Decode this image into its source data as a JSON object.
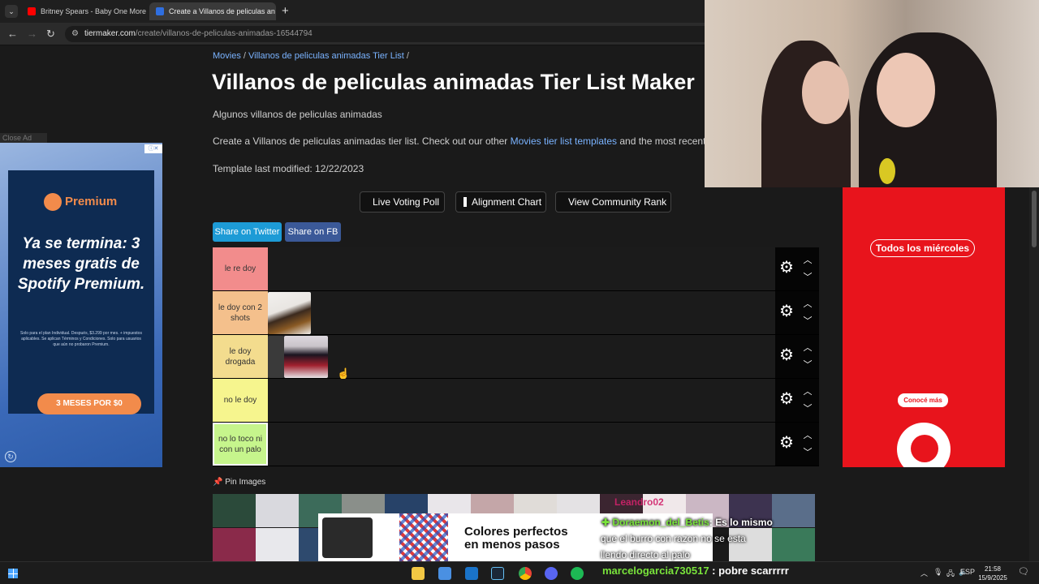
{
  "browser": {
    "tabs": [
      {
        "title": "Britney Spears - Baby One More",
        "icon": "youtube-icon",
        "icon_color": "#ff0000"
      },
      {
        "title": "Create a Villanos de peliculas an",
        "icon": "tiermaker-icon",
        "icon_color": "#2f6fe0"
      }
    ],
    "new_tab_label": "+",
    "url_domain": "tiermaker.com",
    "url_path": "/create/villanos-de-peliculas-animadas-16544794"
  },
  "page": {
    "breadcrumb": [
      "Movies",
      "Villanos de peliculas animadas Tier List"
    ],
    "breadcrumb_sep": "/",
    "title": "Villanos de peliculas animadas Tier List Maker",
    "description": "Algunos villanos de peliculas animadas",
    "create_text_before": "Create a Villanos de peliculas animadas tier list. Check out our other ",
    "create_link": "Movies tier list templates",
    "create_text_after": " and the most recent user s",
    "modified": "Template last modified: 12/22/2023",
    "buttons": {
      "live_voting": "Live Voting Poll",
      "alignment": "Alignment Chart",
      "community_rank": "View Community Rank",
      "share_twitter": "Share on Twitter",
      "share_fb": "Share on FB"
    },
    "tiers": [
      {
        "label": "le re doy",
        "color": "#f28c8c",
        "items": []
      },
      {
        "label": "le doy con 2 shots",
        "color": "#f4c08c",
        "items": [
          "Scar"
        ]
      },
      {
        "label": "le doy drogada",
        "color": "#f3dc8e",
        "items": [
          "Unknown villain",
          "Jafar"
        ]
      },
      {
        "label": "no le doy",
        "color": "#f6f58e",
        "items": []
      },
      {
        "label": "no lo toco ni con un palo",
        "color": "#c6f58c",
        "items": []
      }
    ],
    "pin_images": "Pin Images"
  },
  "ads": {
    "close_ad": "Close Ad",
    "left": {
      "brand": "Premium",
      "headline": "Ya se termina: 3 meses gratis de Spotify Premium.",
      "fine_print": "Solo para el plan Individual. Después, $3.299 por mes. + impuestos aplicables. Se aplican Términos y Condiciones. Solo para usuarios que aún no probaron Premium.",
      "cta": "3 MESES POR $0"
    },
    "right": {
      "pill": "Todos los miércoles",
      "button": "Conocé más"
    }
  },
  "overlay": {
    "banner_text_line1": "Colores perfectos",
    "banner_text_line2": "en menos pasos",
    "chat_ghost": "Leandro02",
    "chat_user": "Doraemon_del_Betis",
    "chat_msg": ": Es lo mismo",
    "chat_line2": "que el burro con razon no se esta",
    "chat_line3": "llendo directo al palo"
  },
  "taskbar": {
    "chat_user": "marcelogarcia730517",
    "chat_msg": " : pobre scarrrrr",
    "lang": "ESP",
    "time": "21:58",
    "date": "15/9/2025"
  }
}
